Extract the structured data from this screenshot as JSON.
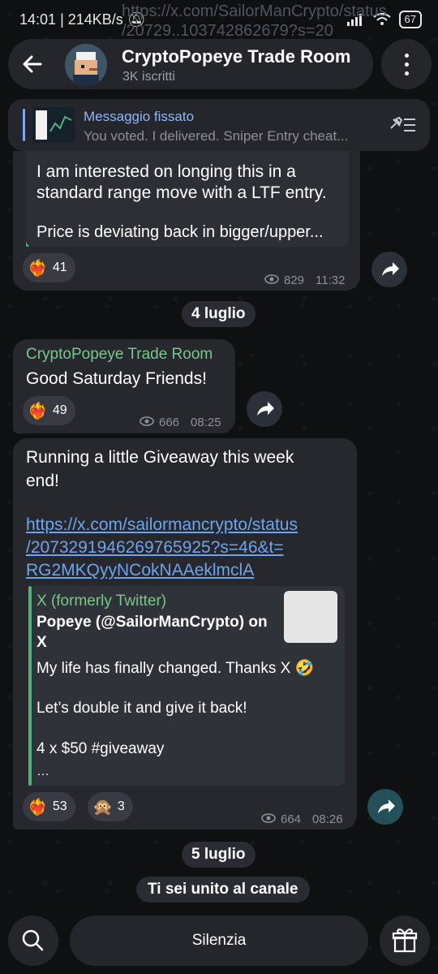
{
  "status_bar": {
    "time": "14:01",
    "speed": "214KB/s",
    "battery": "67"
  },
  "header": {
    "title": "CryptoPopeye Trade Room",
    "subscribers": "3K iscritti"
  },
  "overlay_url": {
    "line1": "https://x.com/SailorManCrypto/status",
    "line2": "/20729..103742862679?s=20"
  },
  "pinned": {
    "label": "Messaggio fissato",
    "text": "You voted. I delivered.  Sniper Entry cheat..."
  },
  "msg1": {
    "line1": "I am interested on longing this in a",
    "line2": "standard range move with a LTF entry.",
    "line3": "Price is deviating back in bigger/upper...",
    "reaction_emoji": "❤️‍🔥",
    "reaction_count": "41",
    "views": "829",
    "time": "11:32"
  },
  "date1": "4 luglio",
  "msg2": {
    "sender": "CryptoPopeye Trade Room",
    "text": "Good Saturday Friends!",
    "reaction_emoji": "❤️‍🔥",
    "reaction_count": "49",
    "views": "666",
    "time": "08:25"
  },
  "msg3": {
    "line1": "Running a little Giveaway this week",
    "line2": "end!",
    "link1": "https://x.com/sailormancrypto/status",
    "link2": "/2073291946269765925?s=46&t=",
    "link3": "RG2MKQyyNCokNAAeklmclA",
    "preview": {
      "site": "X (formerly Twitter)",
      "title1": "Popeye (@SailorManCrypto) on",
      "title2": "X",
      "body1": "My life has finally changed. Thanks X 🤣",
      "body2": "Let’s double it and give it back!",
      "body3": "4 x $50 #giveaway",
      "ellipsis": "…"
    },
    "reaction1_emoji": "❤️‍🔥",
    "reaction1_count": "53",
    "reaction2_emoji": "🙊",
    "reaction2_count": "3",
    "views": "664",
    "time": "08:26"
  },
  "date2": "5 luglio",
  "service_msg": "Ti sei unito al canale",
  "bottom": {
    "mute_label": "Silenzia"
  }
}
